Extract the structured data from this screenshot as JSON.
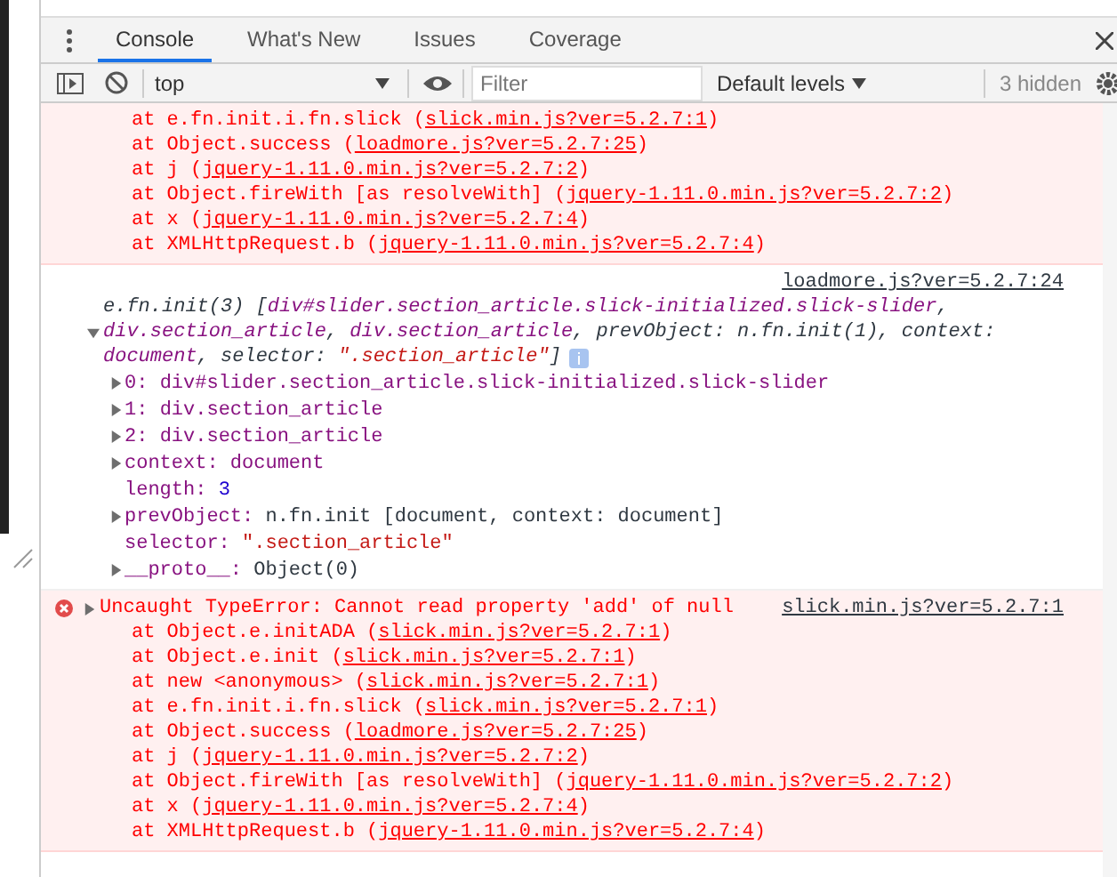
{
  "tabs": [
    {
      "label": "Console",
      "selected": true
    },
    {
      "label": "What's New",
      "selected": false
    },
    {
      "label": "Issues",
      "selected": false
    },
    {
      "label": "Coverage",
      "selected": false
    }
  ],
  "toolbar": {
    "context": "top",
    "filter_placeholder": "Filter",
    "levels": "Default levels",
    "hidden_count": "3 hidden"
  },
  "entries": [
    {
      "kind": "error",
      "stack": [
        {
          "text": "at e.fn.init.i.fn.slick (",
          "link": "slick.min.js?ver=5.2.7:1",
          "tail": ")"
        },
        {
          "text": "at Object.success (",
          "link": "loadmore.js?ver=5.2.7:25",
          "tail": ")"
        },
        {
          "text": "at j (",
          "link": "jquery-1.11.0.min.js?ver=5.2.7:2",
          "tail": ")"
        },
        {
          "text": "at Object.fireWith [as resolveWith] (",
          "link": "jquery-1.11.0.min.js?ver=5.2.7:2",
          "tail": ")"
        },
        {
          "text": "at x (",
          "link": "jquery-1.11.0.min.js?ver=5.2.7:4",
          "tail": ")"
        },
        {
          "text": "at XMLHttpRequest.b (",
          "link": "jquery-1.11.0.min.js?ver=5.2.7:4",
          "tail": ")"
        }
      ]
    },
    {
      "kind": "log",
      "expanded": true,
      "source": "loadmore.js?ver=5.2.7:24",
      "header": [
        [
          {
            "text": "e.fn.init(3) [",
            "kind": "plain"
          },
          {
            "text": "div#slider.section_article.slick-initialized.slick-slider",
            "kind": "node"
          },
          {
            "text": ",",
            "kind": "plain"
          }
        ],
        [
          {
            "text": "div.section_article",
            "kind": "node"
          },
          {
            "text": ", ",
            "kind": "plain"
          },
          {
            "text": "div.section_article",
            "kind": "node"
          },
          {
            "text": ", ",
            "kind": "plain"
          },
          {
            "text": "prevObject: n.fn.init(1), context:",
            "kind": "plain"
          }
        ],
        [
          {
            "text": "document",
            "kind": "node"
          },
          {
            "text": ", selector: ",
            "kind": "plain"
          },
          {
            "text": "\".section_article\"",
            "kind": "string"
          },
          {
            "text": "]",
            "kind": "plain"
          }
        ]
      ],
      "properties": [
        {
          "key": "0:",
          "value": "div#slider.section_article.slick-initialized.slick-slider",
          "kind": "node",
          "expandable": true
        },
        {
          "key": "1:",
          "value": "div.section_article",
          "kind": "node",
          "expandable": true
        },
        {
          "key": "2:",
          "value": "div.section_article",
          "kind": "node",
          "expandable": true
        },
        {
          "key": "context:",
          "value": "document",
          "kind": "node",
          "expandable": true
        },
        {
          "key": "length:",
          "value": "3",
          "kind": "number",
          "expandable": false
        },
        {
          "key": "prevObject:",
          "value": "n.fn.init [document, context: document]",
          "kind": "object",
          "expandable": true
        },
        {
          "key": "selector:",
          "value": "\".section_article\"",
          "kind": "string",
          "expandable": false
        },
        {
          "key": "__proto__:",
          "value": "Object(0)",
          "kind": "object",
          "expandable": true
        }
      ]
    },
    {
      "kind": "error",
      "expanded": false,
      "message": "Uncaught TypeError: Cannot read property 'add' of null",
      "source": "slick.min.js?ver=5.2.7:1",
      "stack": [
        {
          "text": "at Object.e.initADA (",
          "link": "slick.min.js?ver=5.2.7:1",
          "tail": ")"
        },
        {
          "text": "at Object.e.init (",
          "link": "slick.min.js?ver=5.2.7:1",
          "tail": ")"
        },
        {
          "text": "at new <anonymous> (",
          "link": "slick.min.js?ver=5.2.7:1",
          "tail": ")"
        },
        {
          "text": "at e.fn.init.i.fn.slick (",
          "link": "slick.min.js?ver=5.2.7:1",
          "tail": ")"
        },
        {
          "text": "at Object.success (",
          "link": "loadmore.js?ver=5.2.7:25",
          "tail": ")"
        },
        {
          "text": "at j (",
          "link": "jquery-1.11.0.min.js?ver=5.2.7:2",
          "tail": ")"
        },
        {
          "text": "at Object.fireWith [as resolveWith] (",
          "link": "jquery-1.11.0.min.js?ver=5.2.7:2",
          "tail": ")"
        },
        {
          "text": "at x (",
          "link": "jquery-1.11.0.min.js?ver=5.2.7:4",
          "tail": ")"
        },
        {
          "text": "at XMLHttpRequest.b (",
          "link": "jquery-1.11.0.min.js?ver=5.2.7:4",
          "tail": ")"
        }
      ]
    }
  ]
}
